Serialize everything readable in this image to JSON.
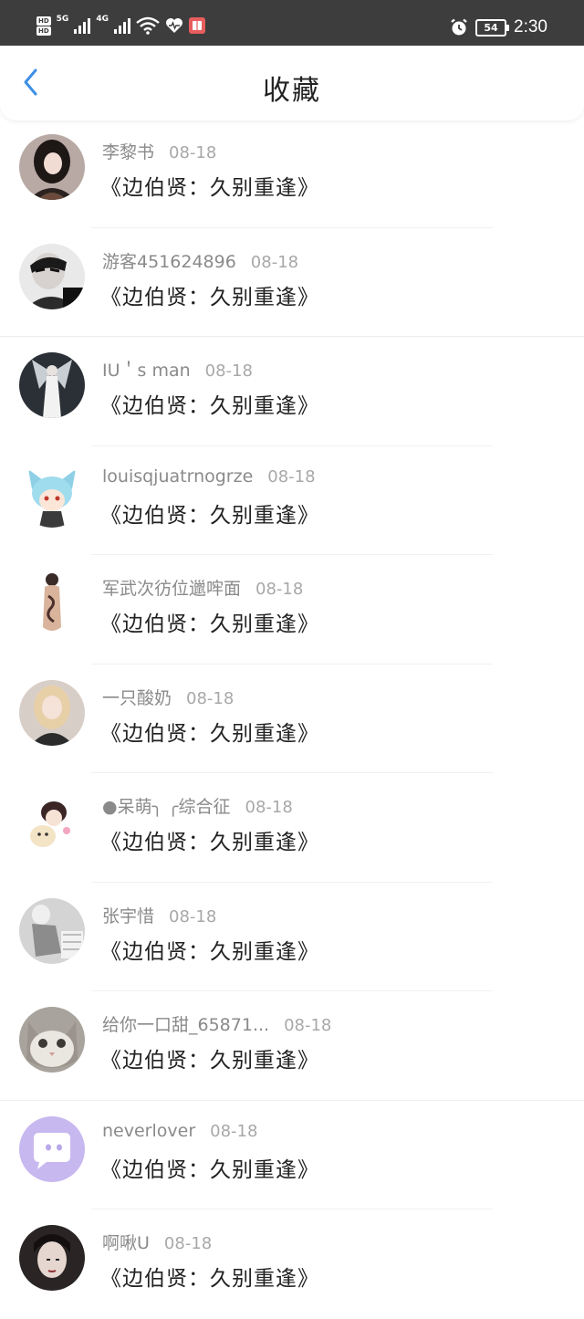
{
  "status_bar": {
    "hd1": "HD",
    "net1": "5G",
    "hd2": "HD",
    "net2": "4G",
    "battery": "54",
    "time": "2:30"
  },
  "header": {
    "title": "收藏",
    "back_icon": "chevron-left-icon",
    "accent": "#3d8fe6"
  },
  "items": [
    {
      "user": "李黎书",
      "date": "08-18",
      "title": "《边伯贤：久别重逢》"
    },
    {
      "user": "游客451624896",
      "date": "08-18",
      "title": "《边伯贤：久别重逢》"
    },
    {
      "user": "IU＇s man",
      "date": "08-18",
      "title": "《边伯贤：久别重逢》"
    },
    {
      "user": "louisqjuatrnogrze",
      "date": "08-18",
      "title": "《边伯贤：久别重逢》"
    },
    {
      "user": "军武次彷位邋哰面",
      "date": "08-18",
      "title": "《边伯贤：久别重逢》"
    },
    {
      "user": "一只酸奶",
      "date": "08-18",
      "title": "《边伯贤：久别重逢》"
    },
    {
      "user": "●呆萌╮ ╭综合征",
      "date": "08-18",
      "title": "《边伯贤：久别重逢》"
    },
    {
      "user": "张宇惜",
      "date": "08-18",
      "title": "《边伯贤：久别重逢》"
    },
    {
      "user": "给你一口甜_65871...",
      "date": "08-18",
      "title": "《边伯贤：久别重逢》"
    },
    {
      "user": "neverlover",
      "date": "08-18",
      "title": "《边伯贤：久别重逢》"
    },
    {
      "user": "啊啾U",
      "date": "08-18",
      "title": "《边伯贤：久别重逢》"
    }
  ]
}
